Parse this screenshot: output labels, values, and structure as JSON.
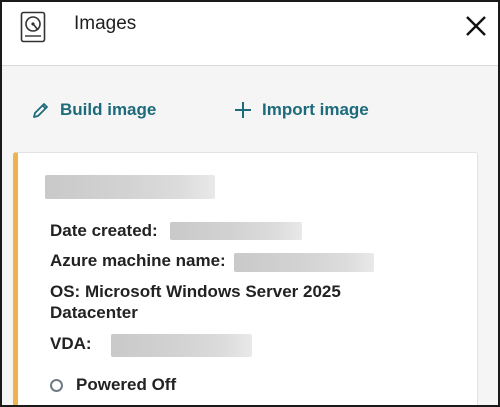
{
  "header": {
    "title": "Images",
    "icon": "disk-image-icon",
    "close_icon": "close-icon"
  },
  "actions": {
    "build_label": "Build image",
    "import_label": "Import image"
  },
  "card": {
    "accent_color": "#f0b24a",
    "date_created_label": "Date created:",
    "azure_machine_label": "Azure machine name:",
    "os_line1": "OS: Microsoft Windows Server 2025",
    "os_line2": "Datacenter",
    "vda_label": "VDA:",
    "status": "Powered Off"
  },
  "colors": {
    "link": "#1d6b7a",
    "status_dot": "#6e7b86"
  }
}
